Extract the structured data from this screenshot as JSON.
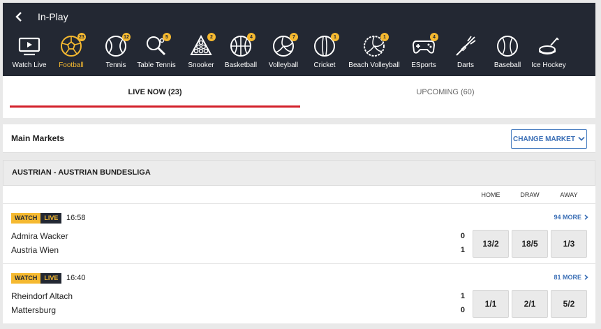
{
  "header": {
    "title": "In-Play"
  },
  "sports": [
    {
      "label": "Watch Live",
      "icon": "tv-icon",
      "badge": ""
    },
    {
      "label": "Football",
      "icon": "football-icon",
      "badge": "23",
      "active": true
    },
    {
      "label": "Tennis",
      "icon": "tennis-ball-icon",
      "badge": "12"
    },
    {
      "label": "Table Tennis",
      "icon": "table-tennis-icon",
      "badge": "5"
    },
    {
      "label": "Snooker",
      "icon": "snooker-icon",
      "badge": "2"
    },
    {
      "label": "Basketball",
      "icon": "basketball-icon",
      "badge": "4"
    },
    {
      "label": "Volleyball",
      "icon": "volleyball-icon",
      "badge": "7"
    },
    {
      "label": "Cricket",
      "icon": "cricket-icon",
      "badge": "1"
    },
    {
      "label": "Beach Volleyball",
      "icon": "beach-volleyball-icon",
      "badge": "1"
    },
    {
      "label": "ESports",
      "icon": "gamepad-icon",
      "badge": "4"
    },
    {
      "label": "Darts",
      "icon": "dart-icon",
      "badge": ""
    },
    {
      "label": "Baseball",
      "icon": "baseball-icon",
      "badge": ""
    },
    {
      "label": "Ice Hockey",
      "icon": "ice-hockey-icon",
      "badge": ""
    }
  ],
  "tabs": {
    "live": "LIVE NOW (23)",
    "upcoming": "UPCOMING (60)"
  },
  "markets": {
    "title": "Main Markets",
    "change_label": "CHANGE MARKET"
  },
  "league": {
    "title": "AUSTRIAN - AUSTRIAN BUNDESLIGA"
  },
  "columns": {
    "home": "HOME",
    "draw": "DRAW",
    "away": "AWAY"
  },
  "matches": [
    {
      "watch": "WATCH",
      "live": "LIVE",
      "time": "16:58",
      "more": "94 MORE",
      "home_team": "Admira Wacker",
      "away_team": "Austria Wien",
      "home_score": "0",
      "away_score": "1",
      "odds": {
        "home": "13/2",
        "draw": "18/5",
        "away": "1/3"
      }
    },
    {
      "watch": "WATCH",
      "live": "LIVE",
      "time": "16:40",
      "more": "81 MORE",
      "home_team": "Rheindorf Altach",
      "away_team": "Mattersburg",
      "home_score": "1",
      "away_score": "0",
      "odds": {
        "home": "1/1",
        "draw": "2/1",
        "away": "5/2"
      }
    }
  ],
  "colors": {
    "accent": "#f5b930",
    "dark": "#232833",
    "live_red": "#d3202a",
    "link_blue": "#3b6fb6"
  }
}
